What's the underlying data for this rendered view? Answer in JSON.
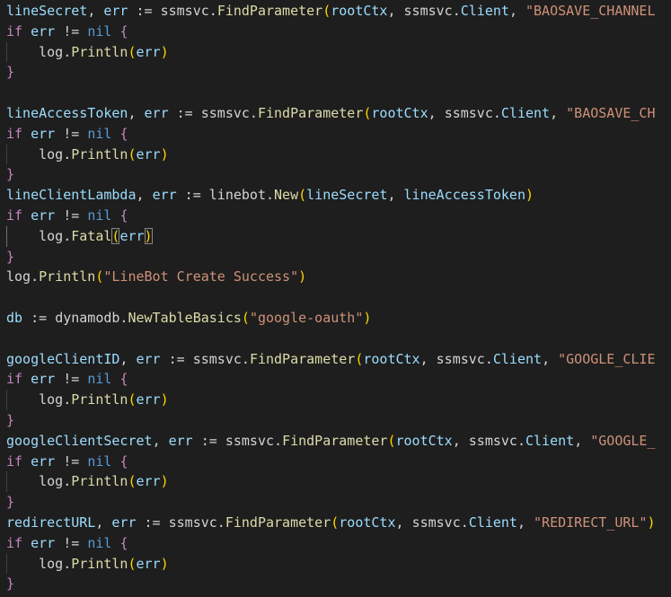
{
  "editor": {
    "lines": [
      [
        [
          "var",
          "lineSecret"
        ],
        [
          "punc",
          ", "
        ],
        [
          "var",
          "err"
        ],
        [
          "op",
          " := "
        ],
        [
          "pkg",
          "ssmsvc."
        ],
        [
          "fn",
          "FindParameter"
        ],
        [
          "paren",
          "("
        ],
        [
          "var",
          "rootCtx"
        ],
        [
          "punc",
          ", "
        ],
        [
          "pkg",
          "ssmsvc."
        ],
        [
          "var",
          "Client"
        ],
        [
          "punc",
          ", "
        ],
        [
          "str",
          "\"BAOSAVE_CHANNEL"
        ]
      ],
      [
        [
          "kw",
          "if"
        ],
        [
          "op",
          " "
        ],
        [
          "var",
          "err"
        ],
        [
          "op",
          " != "
        ],
        [
          "nil",
          "nil"
        ],
        [
          "op",
          " "
        ],
        [
          "brace1",
          "{"
        ]
      ],
      [
        [
          "op",
          "    "
        ],
        [
          "pkg",
          "log."
        ],
        [
          "fn",
          "Println"
        ],
        [
          "paren",
          "("
        ],
        [
          "var",
          "err"
        ],
        [
          "paren",
          ")"
        ]
      ],
      [
        [
          "brace1",
          "}"
        ]
      ],
      [],
      [
        [
          "var",
          "lineAccessToken"
        ],
        [
          "punc",
          ", "
        ],
        [
          "var",
          "err"
        ],
        [
          "op",
          " := "
        ],
        [
          "pkg",
          "ssmsvc."
        ],
        [
          "fn",
          "FindParameter"
        ],
        [
          "paren",
          "("
        ],
        [
          "var",
          "rootCtx"
        ],
        [
          "punc",
          ", "
        ],
        [
          "pkg",
          "ssmsvc."
        ],
        [
          "var",
          "Client"
        ],
        [
          "punc",
          ", "
        ],
        [
          "str",
          "\"BAOSAVE_CH"
        ]
      ],
      [
        [
          "kw",
          "if"
        ],
        [
          "op",
          " "
        ],
        [
          "var",
          "err"
        ],
        [
          "op",
          " != "
        ],
        [
          "nil",
          "nil"
        ],
        [
          "op",
          " "
        ],
        [
          "brace1",
          "{"
        ]
      ],
      [
        [
          "op",
          "    "
        ],
        [
          "pkg",
          "log."
        ],
        [
          "fn",
          "Println"
        ],
        [
          "paren",
          "("
        ],
        [
          "var",
          "err"
        ],
        [
          "paren",
          ")"
        ]
      ],
      [
        [
          "brace1",
          "}"
        ]
      ],
      [
        [
          "var",
          "lineClientLambda"
        ],
        [
          "punc",
          ", "
        ],
        [
          "var",
          "err"
        ],
        [
          "op",
          " := "
        ],
        [
          "pkg",
          "linebot."
        ],
        [
          "fn",
          "New"
        ],
        [
          "paren",
          "("
        ],
        [
          "var",
          "lineSecret"
        ],
        [
          "punc",
          ", "
        ],
        [
          "var",
          "lineAccessToken"
        ],
        [
          "paren",
          ")"
        ]
      ],
      [
        [
          "kw",
          "if"
        ],
        [
          "op",
          " "
        ],
        [
          "var",
          "err"
        ],
        [
          "op",
          " != "
        ],
        [
          "nil",
          "nil"
        ],
        [
          "op",
          " "
        ],
        [
          "brace1",
          "{"
        ]
      ],
      [
        [
          "op",
          "    "
        ],
        [
          "pkg",
          "log."
        ],
        [
          "fn",
          "Fatal"
        ],
        [
          "paren",
          "("
        ],
        [
          "var",
          "err"
        ],
        [
          "paren",
          ")"
        ]
      ],
      [
        [
          "brace1",
          "}"
        ]
      ],
      [
        [
          "pkg",
          "log."
        ],
        [
          "fn",
          "Println"
        ],
        [
          "paren",
          "("
        ],
        [
          "str",
          "\"LineBot Create Success\""
        ],
        [
          "paren",
          ")"
        ]
      ],
      [],
      [
        [
          "var",
          "db"
        ],
        [
          "op",
          " := "
        ],
        [
          "pkg",
          "dynamodb."
        ],
        [
          "fn",
          "NewTableBasics"
        ],
        [
          "paren",
          "("
        ],
        [
          "str",
          "\"google-oauth\""
        ],
        [
          "paren",
          ")"
        ]
      ],
      [],
      [
        [
          "var",
          "googleClientID"
        ],
        [
          "punc",
          ", "
        ],
        [
          "var",
          "err"
        ],
        [
          "op",
          " := "
        ],
        [
          "pkg",
          "ssmsvc."
        ],
        [
          "fn",
          "FindParameter"
        ],
        [
          "paren",
          "("
        ],
        [
          "var",
          "rootCtx"
        ],
        [
          "punc",
          ", "
        ],
        [
          "pkg",
          "ssmsvc."
        ],
        [
          "var",
          "Client"
        ],
        [
          "punc",
          ", "
        ],
        [
          "str",
          "\"GOOGLE_CLIE"
        ]
      ],
      [
        [
          "kw",
          "if"
        ],
        [
          "op",
          " "
        ],
        [
          "var",
          "err"
        ],
        [
          "op",
          " != "
        ],
        [
          "nil",
          "nil"
        ],
        [
          "op",
          " "
        ],
        [
          "brace1",
          "{"
        ]
      ],
      [
        [
          "op",
          "    "
        ],
        [
          "pkg",
          "log."
        ],
        [
          "fn",
          "Println"
        ],
        [
          "paren",
          "("
        ],
        [
          "var",
          "err"
        ],
        [
          "paren",
          ")"
        ]
      ],
      [
        [
          "brace1",
          "}"
        ]
      ],
      [
        [
          "var",
          "googleClientSecret"
        ],
        [
          "punc",
          ", "
        ],
        [
          "var",
          "err"
        ],
        [
          "op",
          " := "
        ],
        [
          "pkg",
          "ssmsvc."
        ],
        [
          "fn",
          "FindParameter"
        ],
        [
          "paren",
          "("
        ],
        [
          "var",
          "rootCtx"
        ],
        [
          "punc",
          ", "
        ],
        [
          "pkg",
          "ssmsvc."
        ],
        [
          "var",
          "Client"
        ],
        [
          "punc",
          ", "
        ],
        [
          "str",
          "\"GOOGLE_"
        ]
      ],
      [
        [
          "kw",
          "if"
        ],
        [
          "op",
          " "
        ],
        [
          "var",
          "err"
        ],
        [
          "op",
          " != "
        ],
        [
          "nil",
          "nil"
        ],
        [
          "op",
          " "
        ],
        [
          "brace1",
          "{"
        ]
      ],
      [
        [
          "op",
          "    "
        ],
        [
          "pkg",
          "log."
        ],
        [
          "fn",
          "Println"
        ],
        [
          "paren",
          "("
        ],
        [
          "var",
          "err"
        ],
        [
          "paren",
          ")"
        ]
      ],
      [
        [
          "brace1",
          "}"
        ]
      ],
      [
        [
          "var",
          "redirectURL"
        ],
        [
          "punc",
          ", "
        ],
        [
          "var",
          "err"
        ],
        [
          "op",
          " := "
        ],
        [
          "pkg",
          "ssmsvc."
        ],
        [
          "fn",
          "FindParameter"
        ],
        [
          "paren",
          "("
        ],
        [
          "var",
          "rootCtx"
        ],
        [
          "punc",
          ", "
        ],
        [
          "pkg",
          "ssmsvc."
        ],
        [
          "var",
          "Client"
        ],
        [
          "punc",
          ", "
        ],
        [
          "str",
          "\"REDIRECT_URL\""
        ],
        [
          "paren",
          ")"
        ]
      ],
      [
        [
          "kw",
          "if"
        ],
        [
          "op",
          " "
        ],
        [
          "var",
          "err"
        ],
        [
          "op",
          " != "
        ],
        [
          "nil",
          "nil"
        ],
        [
          "op",
          " "
        ],
        [
          "brace1",
          "{"
        ]
      ],
      [
        [
          "op",
          "    "
        ],
        [
          "pkg",
          "log."
        ],
        [
          "fn",
          "Println"
        ],
        [
          "paren",
          "("
        ],
        [
          "var",
          "err"
        ],
        [
          "paren",
          ")"
        ]
      ],
      [
        [
          "brace1",
          "}"
        ]
      ]
    ],
    "colors": {
      "background": "#1e1e1e",
      "variable": "#9cdcfe",
      "function": "#dcdcaa",
      "string": "#ce9178",
      "keyword": "#c586c0",
      "nil": "#569cd6",
      "paren": "#ffd700"
    },
    "cursor_line": 12,
    "matched_bracket_line": 12
  }
}
